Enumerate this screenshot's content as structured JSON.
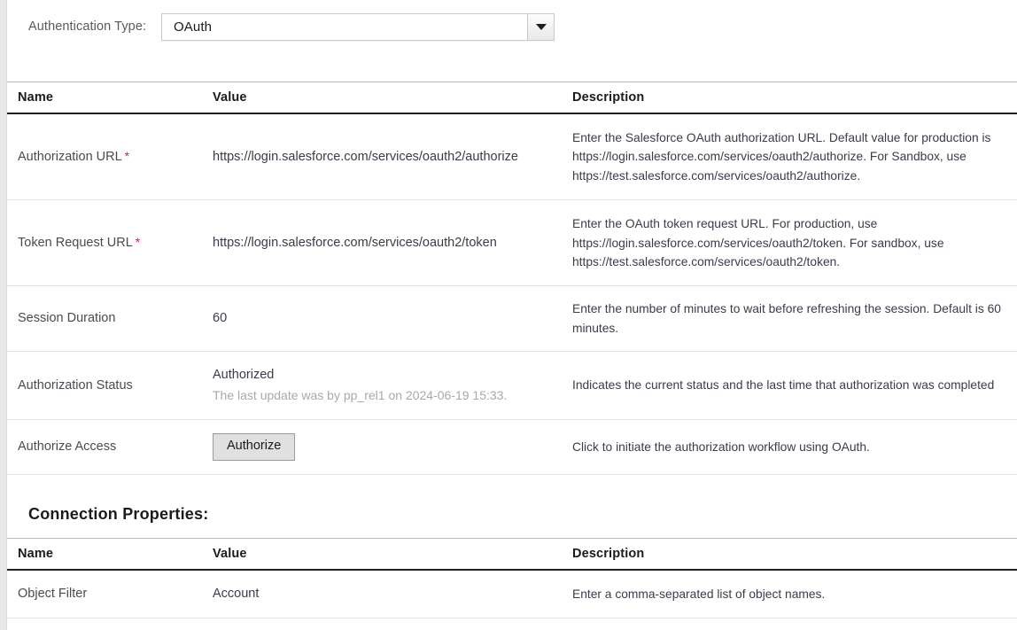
{
  "auth_type": {
    "label": "Authentication Type:",
    "selected": "OAuth",
    "caret_icon": "chevron-down-icon"
  },
  "oauth_table": {
    "headers": {
      "name": "Name",
      "value": "Value",
      "description": "Description"
    },
    "rows": [
      {
        "name": "Authorization URL",
        "required": "*",
        "value": "https://login.salesforce.com/services/oauth2/authorize",
        "description": "Enter the Salesforce OAuth authorization URL. Default value for production is https://login.salesforce.com/services/oauth2/authorize. For Sandbox, use https://test.salesforce.com/services/oauth2/authorize."
      },
      {
        "name": "Token Request URL",
        "required": "*",
        "value": "https://login.salesforce.com/services/oauth2/token",
        "description": "Enter the OAuth token request URL. For production, use https://login.salesforce.com/services/oauth2/token. For sandbox, use https://test.salesforce.com/services/oauth2/token."
      },
      {
        "name": "Session Duration",
        "required": "",
        "value": "60",
        "description": "Enter the number of minutes to wait before refreshing the session. Default is 60 minutes."
      },
      {
        "name": "Authorization Status",
        "required": "",
        "value": "Authorized",
        "value_note": "The last update was by pp_rel1 on 2024-06-19 15:33.",
        "description": "Indicates the current status and the last time that authorization was completed"
      },
      {
        "name": "Authorize Access",
        "required": "",
        "button_label": "Authorize",
        "description": "Click to initiate the authorization workflow using OAuth."
      }
    ]
  },
  "connection_properties": {
    "title": "Connection Properties:",
    "headers": {
      "name": "Name",
      "value": "Value",
      "description": "Description"
    },
    "rows": [
      {
        "name": "Object Filter",
        "value": "Account",
        "description": "Enter a comma-separated list of object names."
      }
    ]
  },
  "colors": {
    "required_asterisk": "#e8192c",
    "header_rule": "#1f1f1f",
    "row_divider": "#e3e3e3",
    "muted_text": "#a9a9ad",
    "button_face": "#e0e0e0"
  }
}
